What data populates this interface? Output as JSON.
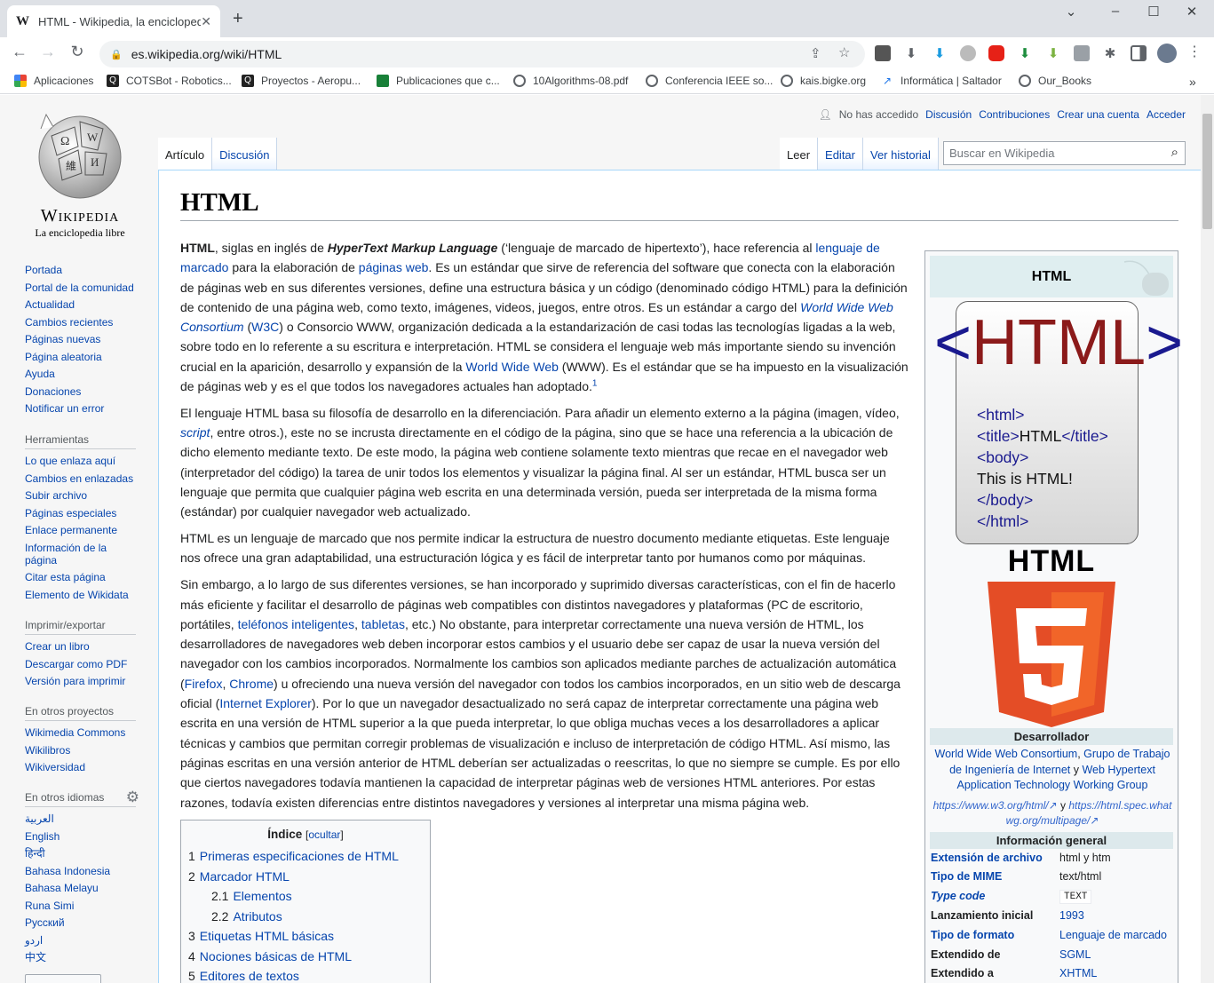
{
  "browser": {
    "tab_title": "HTML - Wikipedia, la enciclopedia libre",
    "tab_favicon": "W",
    "url": "es.wikipedia.org/wiki/HTML",
    "bookmarks": [
      {
        "label": "Aplicaciones",
        "icon": "apps-grid-icon"
      },
      {
        "label": "COTSBot - Robotics...",
        "icon": "qut-icon"
      },
      {
        "label": "Proyectos - Aeropu...",
        "icon": "qut-icon"
      },
      {
        "label": "Publicaciones que c...",
        "icon": "sheets-icon"
      },
      {
        "label": "10Algorithms-08.pdf",
        "icon": "globe-icon"
      },
      {
        "label": "Conferencia IEEE so...",
        "icon": "globe-icon"
      },
      {
        "label": "kais.bigke.org",
        "icon": "globe-icon"
      },
      {
        "label": "Informática | Saltador",
        "icon": "saltador-icon"
      },
      {
        "label": "Our_Books",
        "icon": "globe-icon"
      }
    ]
  },
  "wiki": {
    "wordmark": "Wikipedia",
    "tagline": "La enciclopedia libre",
    "user_nav": {
      "anon": "No has accedido",
      "links": [
        "Discusión",
        "Contribuciones",
        "Crear una cuenta",
        "Acceder"
      ]
    },
    "tabs_left": [
      "Artículo",
      "Discusión"
    ],
    "tabs_right": [
      "Leer",
      "Editar",
      "Ver historial"
    ],
    "search_placeholder": "Buscar en Wikipedia",
    "sidebar": {
      "main": [
        "Portada",
        "Portal de la comunidad",
        "Actualidad",
        "Cambios recientes",
        "Páginas nuevas",
        "Página aleatoria",
        "Ayuda",
        "Donaciones",
        "Notificar un error"
      ],
      "tools_title": "Herramientas",
      "tools": [
        "Lo que enlaza aquí",
        "Cambios en enlazadas",
        "Subir archivo",
        "Páginas especiales",
        "Enlace permanente",
        "Información de la página",
        "Citar esta página",
        "Elemento de Wikidata"
      ],
      "print_title": "Imprimir/exportar",
      "print": [
        "Crear un libro",
        "Descargar como PDF",
        "Versión para imprimir"
      ],
      "projects_title": "En otros proyectos",
      "projects": [
        "Wikimedia Commons",
        "Wikilibros",
        "Wikiversidad"
      ],
      "langs_title": "En otros idiomas",
      "langs": [
        "العربية",
        "English",
        "हिन्दी",
        "Bahasa Indonesia",
        "Bahasa Melayu",
        "Runa Simi",
        "Русский",
        "اردو",
        "中文"
      ]
    },
    "title": "HTML",
    "paragraphs": [
      [
        {
          "t": "HTML",
          "b": 1
        },
        {
          "t": ", siglas en inglés de "
        },
        {
          "t": "HyperText Markup Language",
          "b": 1,
          "i": 1
        },
        {
          "t": " (‘lenguaje de marcado de hipertexto’), hace referencia al "
        },
        {
          "t": "lenguaje de marcado",
          "a": 1
        },
        {
          "t": " para la elaboración de "
        },
        {
          "t": "páginas web",
          "a": 1
        },
        {
          "t": ". Es un estándar que sirve de referencia del software que conecta con la elaboración de páginas web en sus diferentes versiones, define una estructura básica y un código (denominado código HTML) para la definición de contenido de una página web, como texto, imágenes, videos, juegos, entre otros. Es un estándar a cargo del "
        },
        {
          "t": "World Wide Web Consortium",
          "a": 1,
          "i": 1
        },
        {
          "t": " ("
        },
        {
          "t": "W3C",
          "a": 1
        },
        {
          "t": ") o Consorcio WWW, organización dedicada a la estandarización de casi todas las tecnologías ligadas a la web, sobre todo en lo referente a su escritura e interpretación. HTML se considera el lenguaje web más importante siendo su invención crucial en la aparición, desarrollo y expansión de la "
        },
        {
          "t": "World Wide Web",
          "a": 1
        },
        {
          "t": " (WWW). Es el estándar que se ha impuesto en la visualización de páginas web y es el que todos los navegadores actuales han adoptado."
        },
        {
          "t": "1",
          "a": 1,
          "sup": 1
        }
      ],
      [
        {
          "t": "El lenguaje HTML basa su filosofía de desarrollo en la diferenciación. Para añadir un elemento externo a la página (imagen, vídeo, "
        },
        {
          "t": "script",
          "a": 1,
          "i": 1
        },
        {
          "t": ", entre otros.), este no se incrusta directamente en el código de la página, sino que se hace una referencia a la ubicación de dicho elemento mediante texto. De este modo, la página web contiene solamente texto mientras que recae en el navegador web (interpretador del código) la tarea de unir todos los elementos y visualizar la página final. Al ser un estándar, HTML busca ser un lenguaje que permita que cualquier página web escrita en una determinada versión, pueda ser interpretada de la misma forma (estándar) por cualquier navegador web actualizado."
        }
      ],
      [
        {
          "t": "HTML es un lenguaje de marcado que nos permite indicar la estructura de nuestro documento mediante etiquetas. Este lenguaje nos ofrece una gran adaptabilidad, una estructuración lógica y es fácil de interpretar tanto por humanos como por máquinas."
        }
      ],
      [
        {
          "t": "Sin embargo, a lo largo de sus diferentes versiones, se han incorporado y suprimido diversas características, con el fin de hacerlo más eficiente y facilitar el desarrollo de páginas web compatibles con distintos navegadores y plataformas (PC de escritorio, portátiles, "
        },
        {
          "t": "teléfonos inteligentes",
          "a": 1
        },
        {
          "t": ", "
        },
        {
          "t": "tabletas",
          "a": 1
        },
        {
          "t": ", etc.) No obstante, para interpretar correctamente una nueva versión de HTML, los desarrolladores de navegadores web deben incorporar estos cambios y el usuario debe ser capaz de usar la nueva versión del navegador con los cambios incorporados. Normalmente los cambios son aplicados mediante parches de actualización automática ("
        },
        {
          "t": "Firefox",
          "a": 1
        },
        {
          "t": ", "
        },
        {
          "t": "Chrome",
          "a": 1
        },
        {
          "t": ") u ofreciendo una nueva versión del navegador con todos los cambios incorporados, en un sitio web de descarga oficial ("
        },
        {
          "t": "Internet Explorer",
          "a": 1
        },
        {
          "t": "). Por lo que un navegador desactualizado no será capaz de interpretar correctamente una página web escrita en una versión de HTML superior a la que pueda interpretar, lo que obliga muchas veces a los desarrolladores a aplicar técnicas y cambios que permitan corregir problemas de visualización e incluso de interpretación de código HTML. Así mismo, las páginas escritas en una versión anterior de HTML deberían ser actualizadas o reescritas, lo que no siempre se cumple. Es por ello que ciertos navegadores todavía mantienen la capacidad de interpretar páginas web de versiones HTML anteriores. Por estas razones, todavía existen diferencias entre distintos navegadores y versiones al interpretar una misma página web."
        }
      ]
    ],
    "toc": {
      "title": "Índice",
      "toggle": "ocultar",
      "items": [
        {
          "n": "1",
          "t": "Primeras especificaciones de HTML",
          "sub": false
        },
        {
          "n": "2",
          "t": "Marcador HTML",
          "sub": false
        },
        {
          "n": "2.1",
          "t": "Elementos",
          "sub": true
        },
        {
          "n": "2.2",
          "t": "Atributos",
          "sub": true
        },
        {
          "n": "3",
          "t": "Etiquetas HTML básicas",
          "sub": false
        },
        {
          "n": "4",
          "t": "Nociones básicas de HTML",
          "sub": false
        },
        {
          "n": "5",
          "t": "Editores de textos",
          "sub": false
        }
      ]
    },
    "infobox": {
      "title": "HTML",
      "logo_big": "<HTML>",
      "code_lines": [
        [
          {
            "t": "<html>",
            "c": "tag"
          }
        ],
        [
          {
            "t": "<title>",
            "c": "tag"
          },
          {
            "t": "HTML",
            "c": "txt"
          },
          {
            "t": "</title>",
            "c": "tag"
          }
        ],
        [
          {
            "t": "<body>",
            "c": "tag"
          }
        ],
        [
          {
            "t": "This is HTML!",
            "c": "txt"
          }
        ],
        [
          {
            "t": "</body>",
            "c": "tag"
          }
        ],
        [
          {
            "t": "</html>",
            "c": "tag"
          }
        ]
      ],
      "html5_word": "HTML",
      "html5_digit": "5",
      "developer_header": "Desarrollador",
      "developer_text_1": "World Wide Web Consortium",
      "developer_sep_1": ", ",
      "developer_text_2": "Grupo de Trabajo de Ingeniería de Internet",
      "developer_sep_2": " y ",
      "developer_text_3": "Web Hypertext Application Technology Working Group",
      "developer_url_1": "https://www.w3.org/html/",
      "developer_url_sep": " y ",
      "developer_url_2": "https://html.spec.whatwg.org/multipage/",
      "general_header": "Información general",
      "rows": [
        {
          "k": "Extensión de archivo",
          "v": "html y htm",
          "k_link": true,
          "v_link": false
        },
        {
          "k": "Tipo de MIME",
          "v": "text/html",
          "k_link": true,
          "v_link": false
        },
        {
          "k": "Type code",
          "v": "TEXT",
          "k_link": true,
          "v_link": false
        },
        {
          "k": "Lanzamiento inicial",
          "v": "1993",
          "k_link": false,
          "v_link": true
        },
        {
          "k": "Tipo de formato",
          "v": "Lenguaje de marcado",
          "k_link": true,
          "v_link": true
        },
        {
          "k": "Extendido de",
          "v": "SGML",
          "k_link": false,
          "v_link": true
        },
        {
          "k": "Extendido a",
          "v": "XHTML",
          "k_link": false,
          "v_link": true
        }
      ]
    }
  },
  "colors": {
    "link": "#0645ad",
    "html5_orange": "#e44d26",
    "html5_light": "#f16529",
    "tag_color": "#1a1a8f",
    "logo_red": "#8b1a1a"
  }
}
